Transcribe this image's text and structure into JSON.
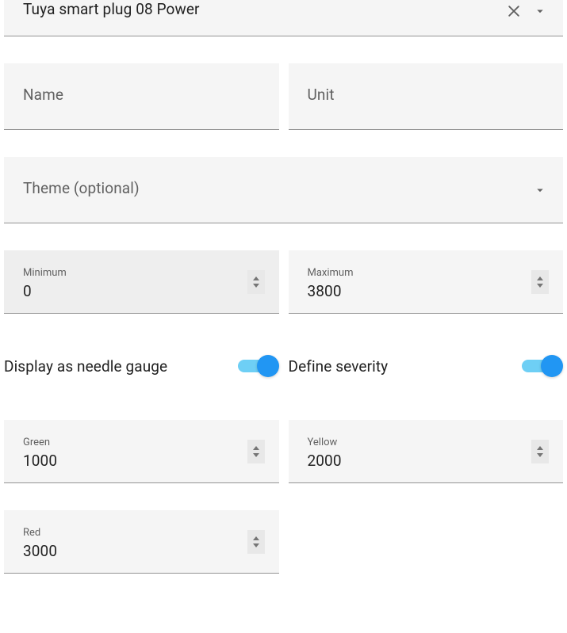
{
  "entity": {
    "value": "Tuya smart plug 08 Power"
  },
  "name": {
    "placeholder": "Name",
    "value": ""
  },
  "unit": {
    "placeholder": "Unit",
    "value": ""
  },
  "theme": {
    "placeholder": "Theme (optional)",
    "value": ""
  },
  "minimum": {
    "label": "Minimum",
    "value": "0"
  },
  "maximum": {
    "label": "Maximum",
    "value": "3800"
  },
  "toggles": {
    "needle": {
      "label": "Display as needle gauge",
      "value": true
    },
    "severity": {
      "label": "Define severity",
      "value": true
    }
  },
  "severity": {
    "green": {
      "label": "Green",
      "value": "1000"
    },
    "yellow": {
      "label": "Yellow",
      "value": "2000"
    },
    "red": {
      "label": "Red",
      "value": "3000"
    }
  }
}
